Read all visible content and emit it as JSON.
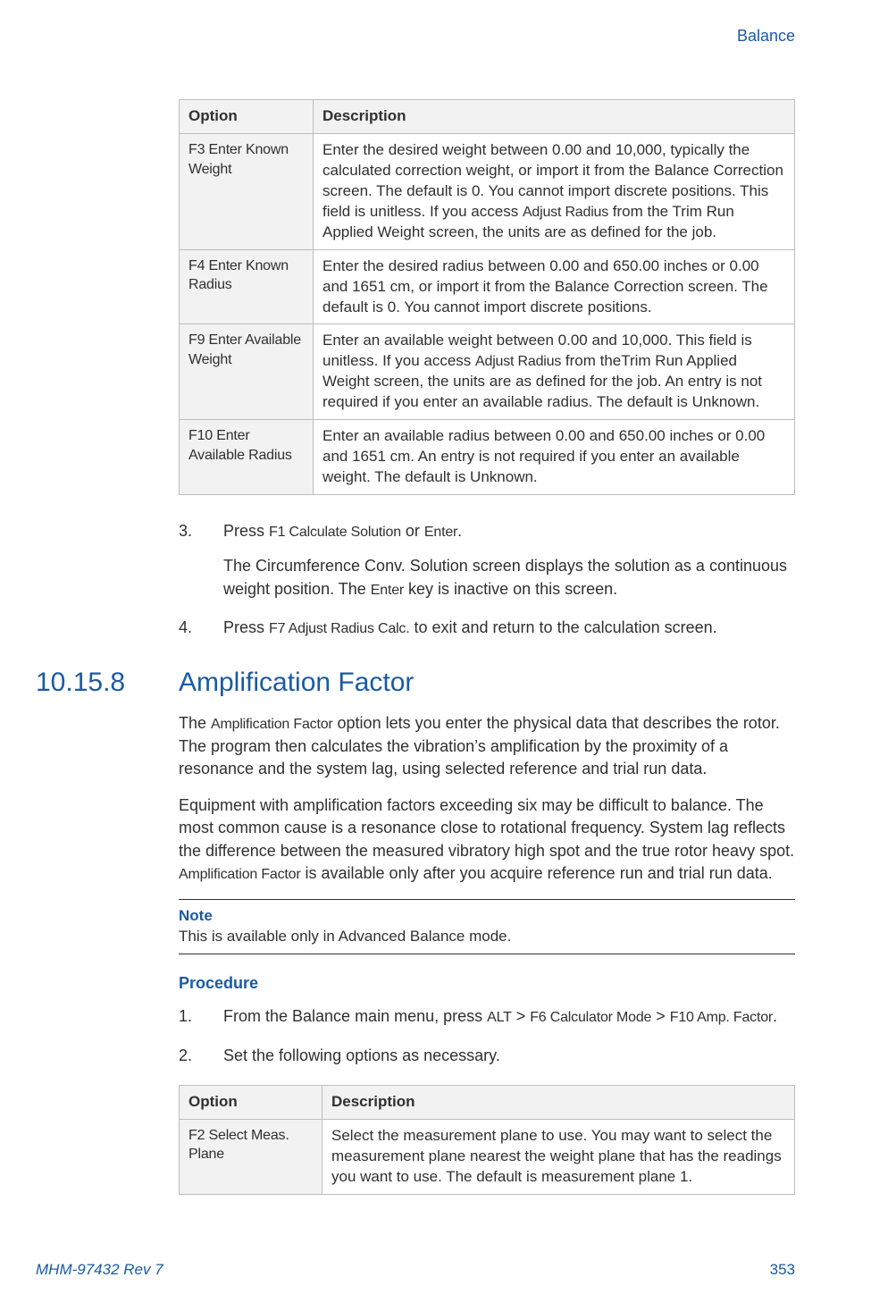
{
  "header": {
    "section": "Balance"
  },
  "table1": {
    "head": {
      "option": "Option",
      "description": "Description"
    },
    "rows": [
      {
        "option": "F3 Enter Known Weight",
        "desc_pre": "Enter the desired weight between 0.00 and 10,000, typically the calculated correction weight, or import it from the Balance Correction screen. The default is 0. You cannot import discrete positions. This field is unitless. If you access ",
        "desc_cond": "Adjust Radius",
        "desc_post": " from the Trim Run Applied Weight screen, the units are as defined for the job."
      },
      {
        "option": "F4 Enter Known Radius",
        "desc_pre": "Enter the desired radius between 0.00 and 650.00 inches or 0.00 and 1651 cm, or import it from the Balance Correction screen. The default is 0. You cannot import discrete positions.",
        "desc_cond": "",
        "desc_post": ""
      },
      {
        "option": "F9 Enter Available Weight",
        "desc_pre": "Enter an available weight between 0.00 and 10,000. This field is unitless. If you access ",
        "desc_cond": "Adjust Radius",
        "desc_post": " from theTrim Run Applied Weight screen, the units are as defined for the job. An entry is not required if you enter an available radius. The default is Unknown."
      },
      {
        "option": "F10 Enter Available Radius",
        "desc_pre": "Enter an available radius between 0.00 and 650.00 inches or 0.00 and 1651 cm. An entry is not required if you enter an available weight. The default is Unknown.",
        "desc_cond": "",
        "desc_post": ""
      }
    ]
  },
  "steps_a": {
    "s3_pre": "Press ",
    "s3_cond1": "F1 Calculate Solution",
    "s3_mid": " or ",
    "s3_cond2": "Enter",
    "s3_post": ".",
    "s3_p_pre": "The Circumference Conv. Solution screen displays the solution as a continuous weight position. The ",
    "s3_p_cond": "Enter",
    "s3_p_post": " key is inactive on this screen.",
    "s4_pre": "Press ",
    "s4_cond": "F7 Adjust Radius Calc.",
    "s4_post": " to exit and return to the calculation screen."
  },
  "section": {
    "num": "10.15.8",
    "title": "Amplification Factor",
    "p1_pre": "The ",
    "p1_cond": "Amplification Factor",
    "p1_post": " option lets you enter the physical data that describes the rotor. The program then calculates the vibration’s amplification by the proximity of a resonance and the system lag, using selected reference and trial run data.",
    "p2_pre": "Equipment with amplification factors exceeding six may be difficult to balance. The most common cause is a resonance close to rotational frequency. System lag reflects the difference between the measured vibratory high spot and the true rotor heavy spot. ",
    "p2_cond": "Amplification Factor",
    "p2_post": " is available only after you acquire reference run and trial run data."
  },
  "note": {
    "label": "Note",
    "body": "This is available only in Advanced Balance mode."
  },
  "procedure": {
    "label": "Procedure",
    "s1_pre": "From the Balance main menu, press ",
    "s1_c1": "ALT",
    "s1_m1": " > ",
    "s1_c2": "F6 Calculator Mode",
    "s1_m2": " > ",
    "s1_c3": "F10 Amp. Factor",
    "s1_post": ".",
    "s2": "Set the following options as necessary."
  },
  "table2": {
    "head": {
      "option": "Option",
      "description": "Description"
    },
    "rows": [
      {
        "option": "F2 Select Meas. Plane",
        "desc": "Select the measurement plane to use. You may want to select the measurement plane nearest the weight plane that has the readings you want to use. The default is measurement plane 1."
      }
    ]
  },
  "footer": {
    "doc": "MHM-97432 Rev 7",
    "page": "353"
  }
}
